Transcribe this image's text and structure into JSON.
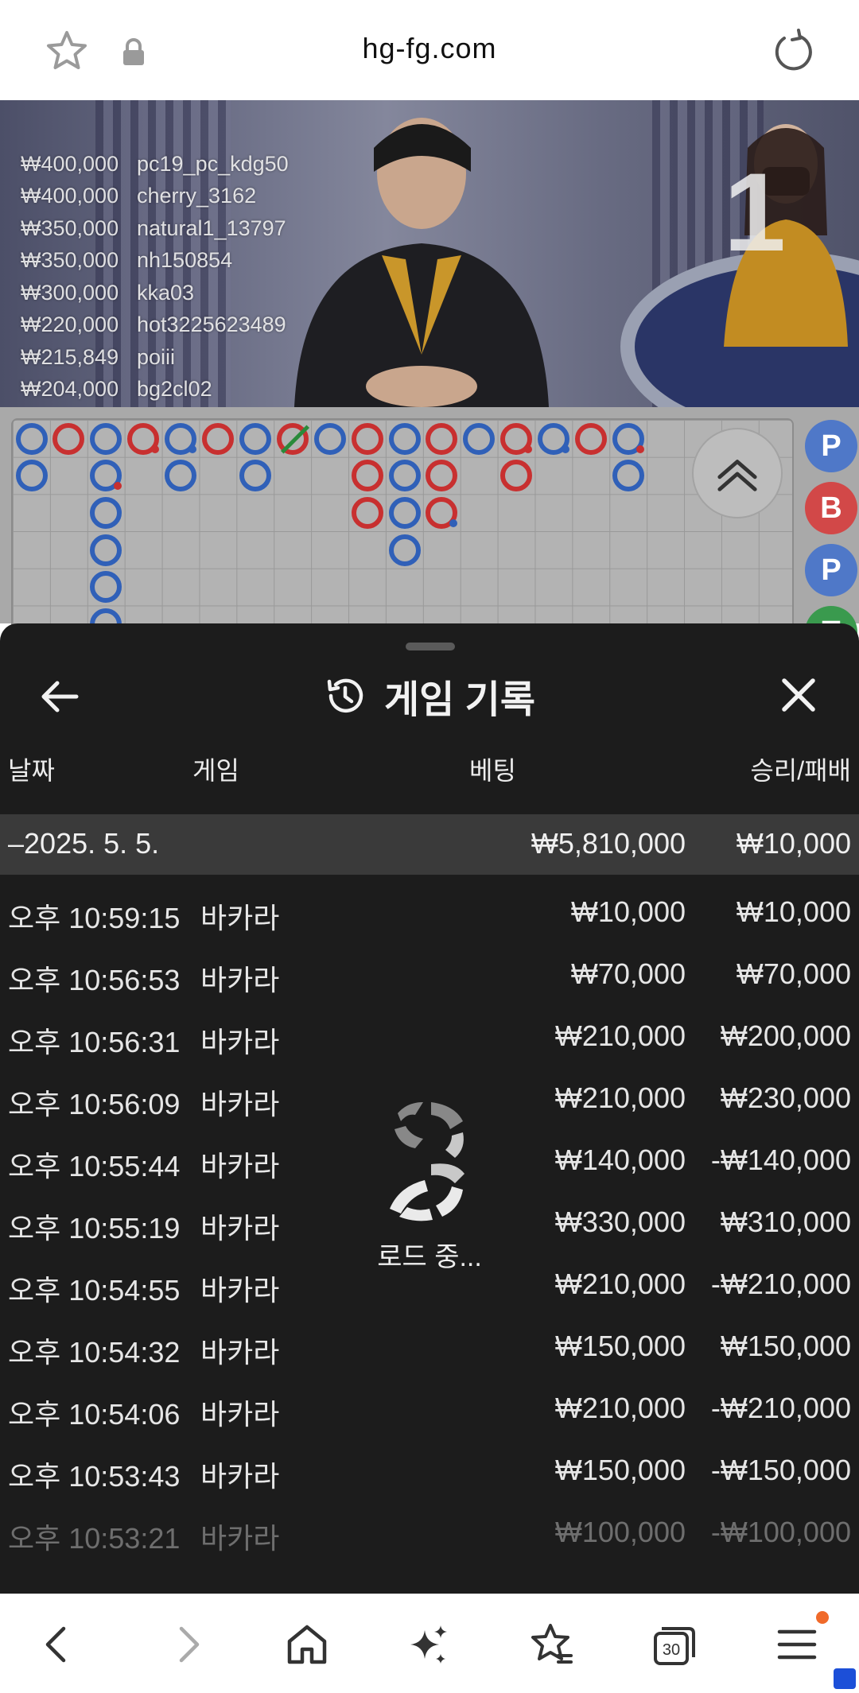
{
  "browser": {
    "url": "hg-fg.com",
    "icons": [
      "star-icon",
      "lock-icon",
      "reload-icon"
    ]
  },
  "video": {
    "round_number": "1",
    "winners": [
      {
        "amount": "₩400,000",
        "user": "pc19_pc_kdg50"
      },
      {
        "amount": "₩400,000",
        "user": "cherry_3162"
      },
      {
        "amount": "₩350,000",
        "user": "natural1_13797"
      },
      {
        "amount": "₩350,000",
        "user": "nh150854"
      },
      {
        "amount": "₩300,000",
        "user": "kka03"
      },
      {
        "amount": "₩220,000",
        "user": "hot3225623489"
      },
      {
        "amount": "₩215,849",
        "user": "poiii"
      },
      {
        "amount": "₩204,000",
        "user": "bg2cl02"
      }
    ]
  },
  "roadmap": {
    "side_labels": [
      "P",
      "B",
      "P",
      "T"
    ],
    "colors": {
      "player": "#3060b8",
      "banker": "#c83030",
      "tie": "#2a8a3a"
    }
  },
  "sheet": {
    "title": "게임 기록",
    "columns": {
      "date": "날짜",
      "game": "게임",
      "bet": "베팅",
      "result": "승리/패배"
    },
    "date_group": {
      "date": "–2025. 5. 5.",
      "bet_total": "₩5,810,000",
      "result_total": "₩10,000"
    },
    "rows": [
      {
        "time": "오후 10:59:15",
        "game": "바카라",
        "bet": "₩10,000",
        "result": "₩10,000"
      },
      {
        "time": "오후 10:56:53",
        "game": "바카라",
        "bet": "₩70,000",
        "result": "₩70,000"
      },
      {
        "time": "오후 10:56:31",
        "game": "바카라",
        "bet": "₩210,000",
        "result": "₩200,000"
      },
      {
        "time": "오후 10:56:09",
        "game": "바카라",
        "bet": "₩210,000",
        "result": "₩230,000"
      },
      {
        "time": "오후 10:55:44",
        "game": "바카라",
        "bet": "₩140,000",
        "result": "-₩140,000"
      },
      {
        "time": "오후 10:55:19",
        "game": "바카라",
        "bet": "₩330,000",
        "result": "₩310,000"
      },
      {
        "time": "오후 10:54:55",
        "game": "바카라",
        "bet": "₩210,000",
        "result": "-₩210,000"
      },
      {
        "time": "오후 10:54:32",
        "game": "바카라",
        "bet": "₩150,000",
        "result": "₩150,000"
      },
      {
        "time": "오후 10:54:06",
        "game": "바카라",
        "bet": "₩210,000",
        "result": "-₩210,000"
      },
      {
        "time": "오후 10:53:43",
        "game": "바카라",
        "bet": "₩150,000",
        "result": "-₩150,000"
      },
      {
        "time": "오후 10:53:21",
        "game": "바카라",
        "bet": "₩100,000",
        "result": "-₩100,000"
      }
    ],
    "loading_text": "로드 중..."
  },
  "bottom_nav": {
    "items": [
      "back-icon",
      "forward-icon",
      "home-icon",
      "sparkle-icon",
      "favorites-icon",
      "tabs-icon",
      "menu-icon"
    ],
    "tab_count": "30"
  }
}
